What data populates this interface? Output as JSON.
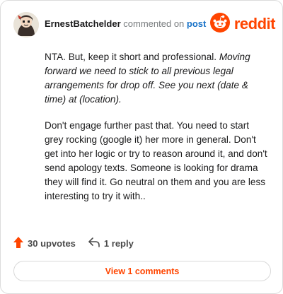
{
  "comment": {
    "author": "ErnestBatchelder",
    "action_text": "commented on",
    "post_link": "post",
    "paragraph1_plain": "NTA. But, keep it short and professional. ",
    "paragraph1_italic": "Moving forward we need to stick to all previous legal arrangements for drop off. See you next (date & time) at (location).",
    "paragraph2": "Don't engage further past that. You need to start grey rocking (google it) her more in general. Don't get into her logic or try to reason around it, and don't send apology texts. Someone is looking for drama they will find it. Go neutral on them and you are less interesting to try it with.."
  },
  "brand": {
    "wordmark": "reddit",
    "color": "#ff4500",
    "icon": "reddit-snoo-icon"
  },
  "actions": {
    "upvotes_label": "30 upvotes",
    "upvote_icon": "upvote-arrow-icon",
    "replies_label": "1 reply",
    "reply_icon": "reply-arrow-icon"
  },
  "footer": {
    "view_comments_label": "View 1 comments"
  },
  "colors": {
    "accent": "#ff4500",
    "link": "#1a73c8",
    "muted": "#787c7e"
  }
}
